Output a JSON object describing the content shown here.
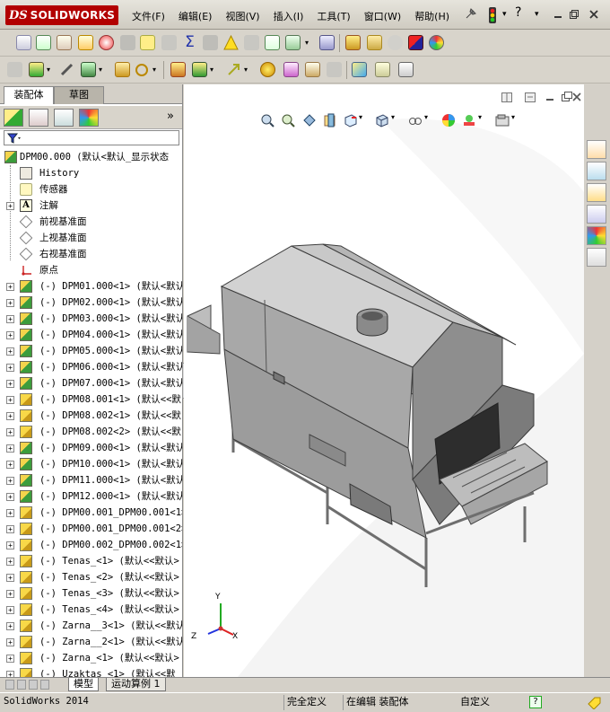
{
  "app": {
    "logo_ds": "DS",
    "logo_text": "SOLIDWORKS",
    "menu": [
      "文件(F)",
      "编辑(E)",
      "视图(V)",
      "插入(I)",
      "工具(T)",
      "窗口(W)",
      "帮助(H)"
    ],
    "help_glyph": "?",
    "window_controls": [
      "minimize-icon",
      "restore-icon",
      "close-icon"
    ]
  },
  "left_panel": {
    "tabs": [
      "装配体",
      "草图"
    ],
    "expand_glyph": "»",
    "tree": [
      {
        "label": "DPM00.000  (默认<默认_显示状态",
        "icon": "assembly-icon",
        "exp": false,
        "indent": 0
      },
      {
        "label": "History",
        "icon": "history-icon",
        "exp": false,
        "indent": 1
      },
      {
        "label": "传感器",
        "icon": "sensor-icon",
        "exp": false,
        "indent": 1
      },
      {
        "label": "注解",
        "icon": "annotation-icon",
        "exp": true,
        "indent": 1
      },
      {
        "label": "前视基准面",
        "icon": "plane-icon",
        "exp": false,
        "indent": 1
      },
      {
        "label": "上视基准面",
        "icon": "plane-icon",
        "exp": false,
        "indent": 1
      },
      {
        "label": "右视基准面",
        "icon": "plane-icon",
        "exp": false,
        "indent": 1
      },
      {
        "label": "原点",
        "icon": "origin-icon",
        "exp": false,
        "indent": 1
      },
      {
        "label": "(-) DPM01.000<1> (默认<默认",
        "icon": "assembly-icon",
        "exp": true,
        "indent": 1
      },
      {
        "label": "(-) DPM02.000<1> (默认<默认",
        "icon": "assembly-icon",
        "exp": true,
        "indent": 1
      },
      {
        "label": "(-) DPM03.000<1> (默认<默认",
        "icon": "assembly-icon",
        "exp": true,
        "indent": 1
      },
      {
        "label": "(-) DPM04.000<1> (默认<默认",
        "icon": "assembly-icon",
        "exp": true,
        "indent": 1
      },
      {
        "label": "(-) DPM05.000<1> (默认<默认",
        "icon": "assembly-icon",
        "exp": true,
        "indent": 1
      },
      {
        "label": "(-) DPM06.000<1> (默认<默认",
        "icon": "assembly-icon",
        "exp": true,
        "indent": 1
      },
      {
        "label": "(-) DPM07.000<1> (默认<默认",
        "icon": "assembly-icon",
        "exp": true,
        "indent": 1
      },
      {
        "label": "(-) DPM08.001<1> (默认<<默",
        "icon": "part-icon",
        "exp": true,
        "indent": 1
      },
      {
        "label": "(-) DPM08.002<1> (默认<<默",
        "icon": "part-icon",
        "exp": true,
        "indent": 1
      },
      {
        "label": "(-) DPM08.002<2> (默认<<默",
        "icon": "part-icon",
        "exp": true,
        "indent": 1
      },
      {
        "label": "(-) DPM09.000<1> (默认<默认",
        "icon": "assembly-icon",
        "exp": true,
        "indent": 1
      },
      {
        "label": "(-) DPM10.000<1> (默认<默认",
        "icon": "assembly-icon",
        "exp": true,
        "indent": 1
      },
      {
        "label": "(-) DPM11.000<1> (默认<默认",
        "icon": "assembly-icon",
        "exp": true,
        "indent": 1
      },
      {
        "label": "(-) DPM12.000<1> (默认<默认",
        "icon": "assembly-icon",
        "exp": true,
        "indent": 1
      },
      {
        "label": "(-) DPM00.001_DPM00.001<1>",
        "icon": "part-icon",
        "exp": true,
        "indent": 1
      },
      {
        "label": "(-) DPM00.001_DPM00.001<2>",
        "icon": "part-icon",
        "exp": true,
        "indent": 1
      },
      {
        "label": "(-) DPM00.002_DPM00.002<1>",
        "icon": "part-icon",
        "exp": true,
        "indent": 1
      },
      {
        "label": "(-) Tenas_<1> (默认<<默认>",
        "icon": "part-icon",
        "exp": true,
        "indent": 1
      },
      {
        "label": "(-) Tenas_<2> (默认<<默认>",
        "icon": "part-icon",
        "exp": true,
        "indent": 1
      },
      {
        "label": "(-) Tenas_<3> (默认<<默认>",
        "icon": "part-icon",
        "exp": true,
        "indent": 1
      },
      {
        "label": "(-) Tenas_<4> (默认<<默认>",
        "icon": "part-icon",
        "exp": true,
        "indent": 1
      },
      {
        "label": "(-) Zarna__3<1> (默认<<默认",
        "icon": "part-icon",
        "exp": true,
        "indent": 1
      },
      {
        "label": "(-) Zarna__2<1> (默认<<默认",
        "icon": "part-icon",
        "exp": true,
        "indent": 1
      },
      {
        "label": "(-) Zarna_<1> (默认<<默认>",
        "icon": "part-icon",
        "exp": true,
        "indent": 1
      },
      {
        "label": "(-) Uzaktas_<1> (默认<<默",
        "icon": "part-icon",
        "exp": true,
        "indent": 1
      }
    ]
  },
  "bottom_tabs": [
    "模型",
    "运动算例 1"
  ],
  "status": {
    "app_version": "SolidWorks 2014",
    "definition": "完全定义",
    "mode": "在编辑 装配体",
    "units": "自定义",
    "help": "?"
  },
  "axes": {
    "x": "X",
    "y": "Y",
    "z": "Z"
  },
  "colors": {
    "brand": "#b20000",
    "model_grey": "#8c8c8c"
  }
}
